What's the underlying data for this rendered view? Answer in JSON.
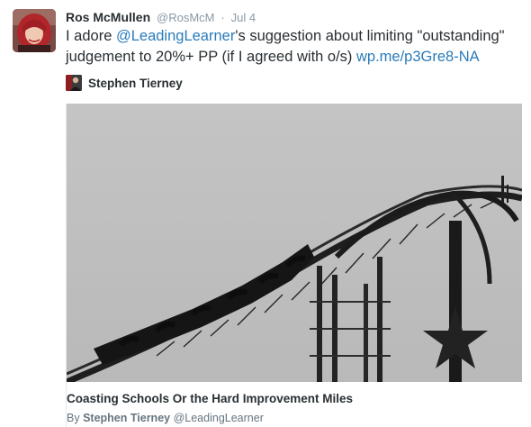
{
  "tweet": {
    "author_name": "Ros McMullen",
    "author_handle": "@RosMcM",
    "separator": "·",
    "timestamp": "Jul 4",
    "text_part1": "I adore ",
    "mention": "@LeadingLearner",
    "text_part2": "'s suggestion about limiting \"outstanding\" judgement to 20%+ PP (if I agreed with o/s) ",
    "url": "wp.me/p3Gre8-NA"
  },
  "attribution": {
    "name": "Stephen Tierney"
  },
  "card": {
    "title": "Coasting Schools Or the Hard Improvement Miles",
    "byline_prefix": "By",
    "byline_name": "Stephen Tierney",
    "byline_handle": "@LeadingLearner"
  },
  "colors": {
    "link": "#2b7bb9",
    "muted": "#8899a6",
    "text": "#292f33"
  }
}
